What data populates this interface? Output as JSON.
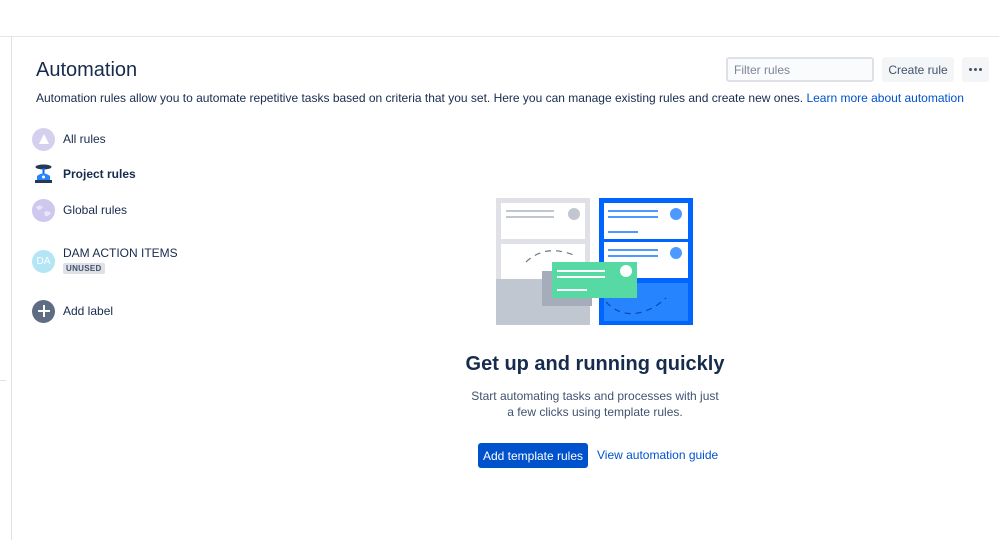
{
  "header": {
    "title": "Automation",
    "description": "Automation rules allow you to automate repetitive tasks based on criteria that you set. Here you can manage existing rules and create new ones.",
    "learn_more_link": "Learn more about automation"
  },
  "toolbar": {
    "filter_placeholder": "Filter rules",
    "create_label": "Create rule",
    "more_icon": "more-icon"
  },
  "sidebar": {
    "items": [
      {
        "label": "All rules",
        "icon": "all-rules-icon",
        "active": false
      },
      {
        "label": "Project rules",
        "icon": "project-rules-icon",
        "active": true
      },
      {
        "label": "Global rules",
        "icon": "globe-icon",
        "active": false
      }
    ],
    "labels": [
      {
        "initials": "DA",
        "name": "DAM ACTION ITEMS",
        "badge": "UNUSED"
      }
    ],
    "add_label": "Add label"
  },
  "empty_state": {
    "title": "Get up and running quickly",
    "text_line1": "Start automating tasks and processes with just",
    "text_line2": "a few clicks using template rules.",
    "primary_button": "Add template rules",
    "guide_link": "View automation guide"
  },
  "colors": {
    "primary": "#0052cc",
    "text": "#172b4d",
    "muted": "#42526e",
    "illustration_blue": "#0065ff",
    "illustration_green": "#57d9a3"
  }
}
